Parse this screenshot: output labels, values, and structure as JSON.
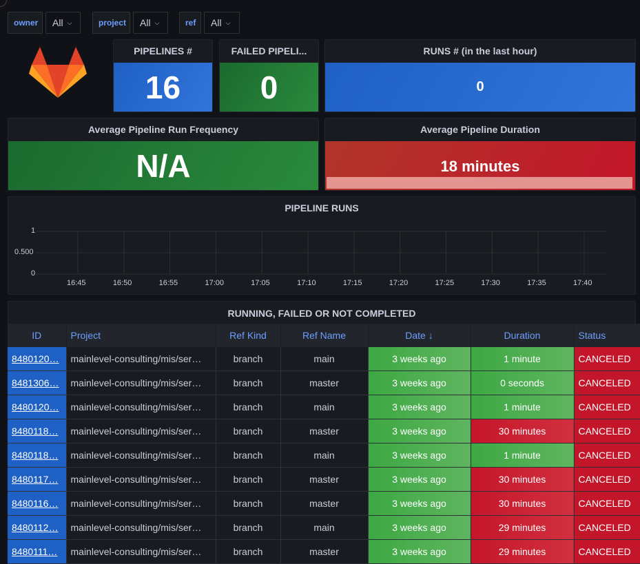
{
  "variables": [
    {
      "label": "owner",
      "value": "All"
    },
    {
      "label": "project",
      "value": "All"
    },
    {
      "label": "ref",
      "value": "All"
    }
  ],
  "stats": {
    "pipelines": {
      "title": "PIPELINES #",
      "value": "16"
    },
    "failed": {
      "title": "FAILED PIPELI...",
      "value": "0"
    },
    "runs": {
      "title": "RUNS # (in the last hour)",
      "value": "0"
    },
    "frequency": {
      "title": "Average Pipeline Run Frequency",
      "value": "N/A"
    },
    "duration": {
      "title": "Average Pipeline Duration",
      "value": "18 minutes"
    }
  },
  "chart": {
    "title": "PIPELINE RUNS",
    "yticks": [
      "1",
      "0.500",
      "0"
    ],
    "xticks": [
      "16:45",
      "16:50",
      "16:55",
      "17:00",
      "17:05",
      "17:10",
      "17:15",
      "17:20",
      "17:25",
      "17:30",
      "17:35",
      "17:40"
    ]
  },
  "chart_data": {
    "type": "line",
    "title": "PIPELINE RUNS",
    "x": [
      "16:45",
      "16:50",
      "16:55",
      "17:00",
      "17:05",
      "17:10",
      "17:15",
      "17:20",
      "17:25",
      "17:30",
      "17:35",
      "17:40"
    ],
    "series": [],
    "ylim": [
      0,
      1
    ],
    "grid": true
  },
  "table": {
    "title": "RUNNING, FAILED OR NOT COMPLETED",
    "headers": [
      "ID",
      "Project",
      "Ref Kind",
      "Ref Name",
      "Date ↓",
      "Duration",
      "Status"
    ],
    "rows": [
      [
        "8480120…",
        "mainlevel-consulting/mis/ser…",
        "branch",
        "main",
        "3 weeks ago",
        "1 minute",
        "CANCELED"
      ],
      [
        "8481306…",
        "mainlevel-consulting/mis/ser…",
        "branch",
        "master",
        "3 weeks ago",
        "0 seconds",
        "CANCELED"
      ],
      [
        "8480120…",
        "mainlevel-consulting/mis/ser…",
        "branch",
        "main",
        "3 weeks ago",
        "1 minute",
        "CANCELED"
      ],
      [
        "8480118…",
        "mainlevel-consulting/mis/ser…",
        "branch",
        "master",
        "3 weeks ago",
        "30 minutes",
        "CANCELED"
      ],
      [
        "8480118…",
        "mainlevel-consulting/mis/ser…",
        "branch",
        "main",
        "3 weeks ago",
        "1 minute",
        "CANCELED"
      ],
      [
        "8480117…",
        "mainlevel-consulting/mis/ser…",
        "branch",
        "master",
        "3 weeks ago",
        "30 minutes",
        "CANCELED"
      ],
      [
        "8480116…",
        "mainlevel-consulting/mis/ser…",
        "branch",
        "master",
        "3 weeks ago",
        "30 minutes",
        "CANCELED"
      ],
      [
        "8480112…",
        "mainlevel-consulting/mis/ser…",
        "branch",
        "main",
        "3 weeks ago",
        "29 minutes",
        "CANCELED"
      ],
      [
        "8480111…",
        "mainlevel-consulting/mis/ser…",
        "branch",
        "master",
        "3 weeks ago",
        "29 minutes",
        "CANCELED"
      ]
    ]
  }
}
